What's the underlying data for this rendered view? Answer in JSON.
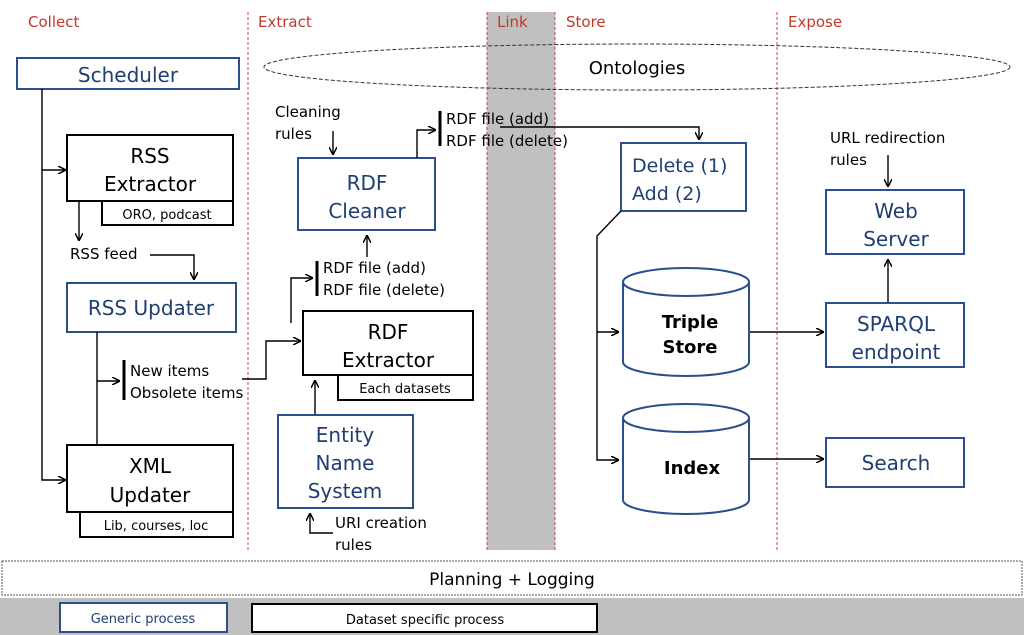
{
  "phases": {
    "collect": "Collect",
    "extract": "Extract",
    "link": "Link",
    "store": "Store",
    "expose": "Expose"
  },
  "ontologies": "Ontologies",
  "collect": {
    "scheduler": "Scheduler",
    "rss_extractor": [
      "RSS",
      "Extractor"
    ],
    "rss_extractor_sub": "ORO, podcast",
    "rss_feed": "RSS feed",
    "rss_updater": "RSS Updater",
    "items": [
      "New items",
      "Obsolete items"
    ],
    "xml_updater": [
      "XML",
      "Updater"
    ],
    "xml_updater_sub": "Lib, courses, loc"
  },
  "extract": {
    "cleaning_rules": [
      "Cleaning",
      "rules"
    ],
    "rdf_cleaner": [
      "RDF",
      "Cleaner"
    ],
    "cleaner_output": [
      "RDF file (add)",
      "RDF file (delete)"
    ],
    "extractor_output": [
      "RDF file (add)",
      "RDF file (delete)"
    ],
    "rdf_extractor": [
      "RDF",
      "Extractor"
    ],
    "rdf_extractor_sub": "Each datasets",
    "ens": [
      "Entity",
      "Name",
      "System"
    ],
    "uri_rules": [
      "URI creation",
      "rules"
    ]
  },
  "store": {
    "delete_add": [
      "Delete (1)",
      "Add (2)"
    ],
    "triple_store": [
      "Triple",
      "Store"
    ],
    "index": "Index"
  },
  "expose": {
    "url_rules": [
      "URL redirection",
      "rules"
    ],
    "web_server": [
      "Web",
      "Server"
    ],
    "sparql": [
      "SPARQL",
      "endpoint"
    ],
    "search": "Search"
  },
  "planning": "Planning + Logging",
  "legend": {
    "generic": "Generic process",
    "specific": "Dataset specific process"
  },
  "colors": {
    "generic_border": "#2a4f8f",
    "specific_border": "#000000",
    "phase_label": "#c0392b",
    "link_band": "#c0c0c0"
  }
}
